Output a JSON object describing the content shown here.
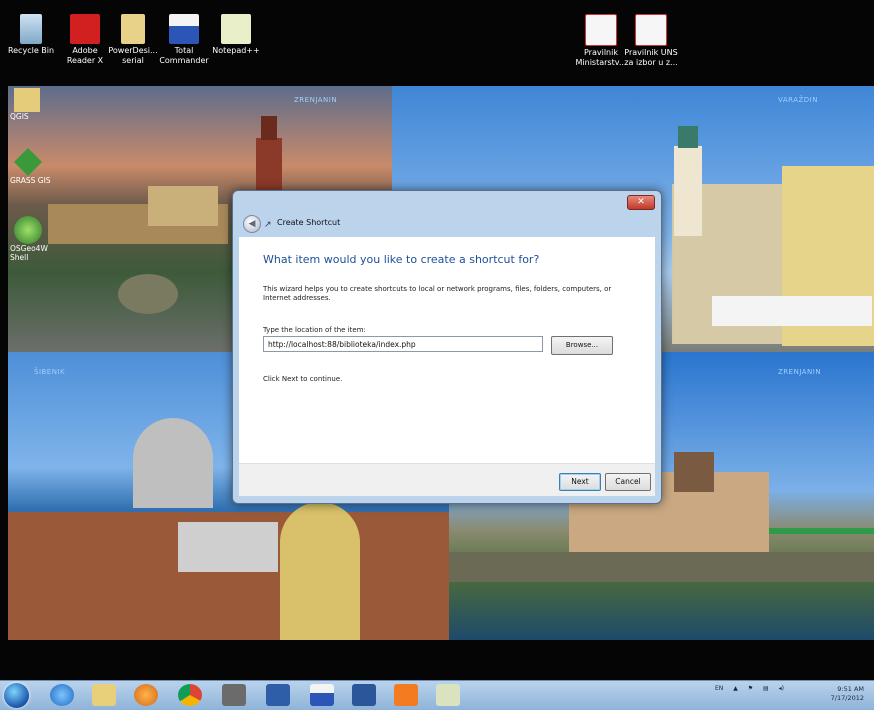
{
  "desktop": {
    "icons_top": [
      {
        "label": "Recycle Bin",
        "icon": "recycle-bin-icon"
      },
      {
        "label": "Adobe\nReader X",
        "icon": "adobe-reader-icon"
      },
      {
        "label": "PowerDesi...\nserial",
        "icon": "folder-icon"
      },
      {
        "label": "Total\nCommander",
        "icon": "floppy-disk-icon"
      },
      {
        "label": "Notepad++",
        "icon": "notepad-icon"
      }
    ],
    "icons_right": [
      {
        "label": "Pravilnik\nMinistarstv...",
        "icon": "pdf-icon"
      },
      {
        "label": "Pravilnik UNS\nza izbor u z...",
        "icon": "pdf-icon"
      }
    ],
    "icons_left": [
      {
        "label": "QGIS",
        "icon": "folder-icon"
      },
      {
        "label": "GRASS GIS",
        "icon": "grass-gis-icon"
      },
      {
        "label": "OSGeo4W\nShell",
        "icon": "osgeo-icon"
      }
    ]
  },
  "wallpaper": {
    "labels": [
      "ZRENJANIN",
      "VARAŽDIN",
      "ŠIBENIK",
      "ZRENJANIN"
    ]
  },
  "dialog": {
    "title": "Create Shortcut",
    "close_label": "✕",
    "heading": "What item would you like to create a shortcut for?",
    "description": "This wizard helps you to create shortcuts to local or network programs, files, folders, computers, or Internet addresses.",
    "location_label": "Type the location of the item:",
    "location_value": "http://localhost:88/biblioteka/index.php",
    "browse_label": "Browse...",
    "hint": "Click Next to continue.",
    "next_label": "Next",
    "cancel_label": "Cancel"
  },
  "taskbar": {
    "pinned": [
      "internet-explorer-icon",
      "file-explorer-icon",
      "media-player-icon",
      "chrome-icon",
      "gimp-icon",
      "paint-icon",
      "total-commander-icon",
      "word-icon",
      "xampp-icon",
      "notepad-icon"
    ],
    "tray_language": "EN",
    "clock_time": "9:51 AM",
    "clock_date": "7/17/2012"
  },
  "colors": {
    "dialog_heading": "#1f4f9a",
    "dialog_frame": "#bcd3ec",
    "close_button": "#c0392b",
    "taskbar": "#9fbfe0"
  }
}
